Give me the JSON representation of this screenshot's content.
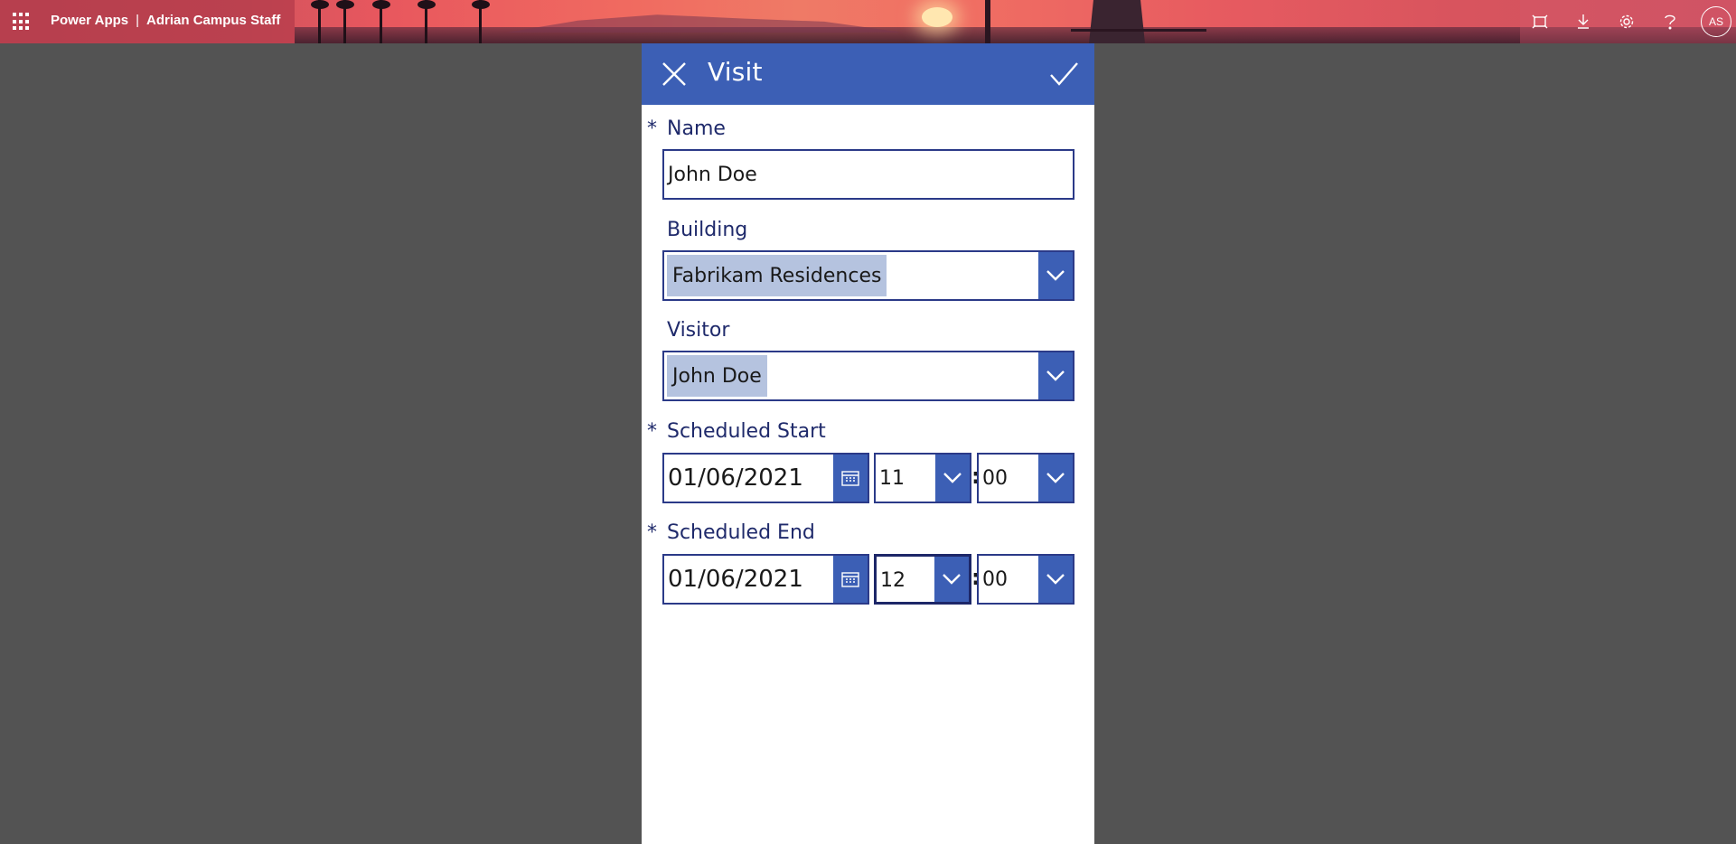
{
  "topbar": {
    "app_name": "Power Apps",
    "separator": "|",
    "environment": "Adrian Campus Staff",
    "icons": [
      "waffle-icon",
      "fit-to-window-icon",
      "download-icon",
      "settings-icon",
      "help-icon"
    ],
    "avatar_initials": "AS"
  },
  "form": {
    "title": "Visit",
    "header_color": "#3c5fb5",
    "label_color": "#1f2a6b",
    "required_marker": "*",
    "name": {
      "label": "Name",
      "value": "John Doe"
    },
    "building": {
      "label": "Building",
      "value": "Fabrikam Residences"
    },
    "visitor": {
      "label": "Visitor",
      "value": "John Doe"
    },
    "scheduled_start": {
      "label": "Scheduled Start",
      "date": "01/06/2021",
      "hour": "11",
      "minute": "00"
    },
    "scheduled_end": {
      "label": "Scheduled End",
      "date": "01/06/2021",
      "hour": "12",
      "minute": "00"
    },
    "time_separator": ":"
  }
}
